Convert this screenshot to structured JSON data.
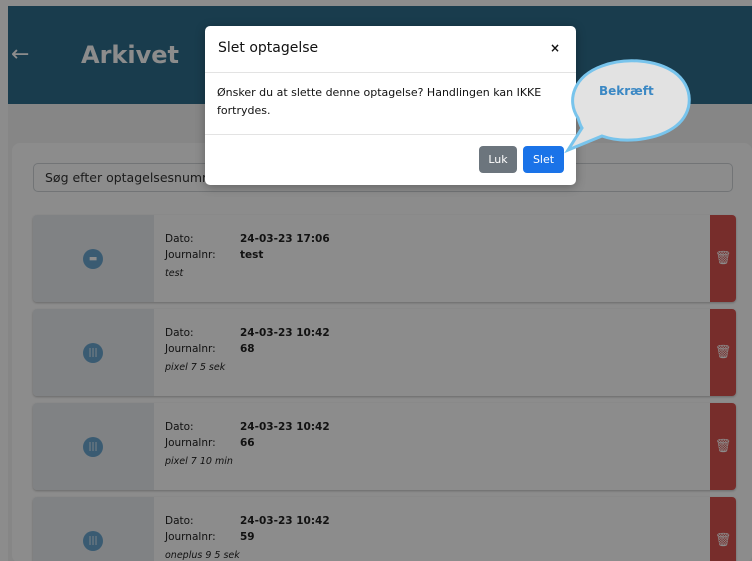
{
  "header": {
    "back_icon": "←",
    "title": "Arkivet"
  },
  "search": {
    "placeholder": "Søg efter optagelsesnummer"
  },
  "labels": {
    "date": "Dato:",
    "journal": "Journalnr:"
  },
  "recordings": [
    {
      "date": "24-03-23 17:06",
      "journal": "test",
      "note": "test",
      "icon": "calendar-icon"
    },
    {
      "date": "24-03-23 10:42",
      "journal": "68",
      "note": "pixel 7 5 sek",
      "icon": "audio-icon"
    },
    {
      "date": "24-03-23 10:42",
      "journal": "66",
      "note": "pixel 7 10 min",
      "icon": "audio-icon"
    },
    {
      "date": "24-03-23 10:42",
      "journal": "59",
      "note": "oneplus 9 5 sek",
      "icon": "audio-icon"
    }
  ],
  "modal": {
    "title": "Slet optagelse",
    "close": "×",
    "body": "Ønsker du at slette denne optagelse? Handlingen kan IKKE fortrydes.",
    "cancel_label": "Luk",
    "confirm_label": "Slet"
  },
  "callout": {
    "text": "Bekræft"
  },
  "colors": {
    "header": "#2f6e8c",
    "danger": "#d9534f",
    "primary": "#1a73e8",
    "secondary": "#6c757d",
    "callout_text": "#3b88c4"
  }
}
